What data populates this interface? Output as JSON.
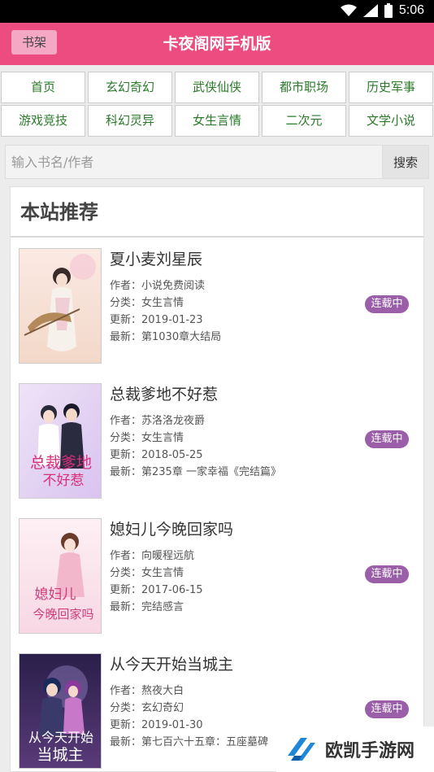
{
  "status": {
    "time": "5:06"
  },
  "header": {
    "shelf_label": "书架",
    "title": "卡夜阁网手机版"
  },
  "nav": [
    "首页",
    "玄幻奇幻",
    "武侠仙侠",
    "都市职场",
    "历史军事",
    "游戏竞技",
    "科幻灵异",
    "女生言情",
    "二次元",
    "文学小说"
  ],
  "search": {
    "placeholder": "输入书名/作者",
    "button_label": "搜索"
  },
  "section": {
    "title": "本站推荐"
  },
  "books": [
    {
      "title": "夏小麦刘星辰",
      "author": "作者：小说免费阅读",
      "category": "分类：女生言情",
      "updated": "更新：2019-01-23",
      "latest": "最新：第1030章大结局",
      "status": "连载中",
      "cover_text": ""
    },
    {
      "title": "总裁爹地不好惹",
      "author": "作者：苏洛洛龙夜爵",
      "category": "分类：女生言情",
      "updated": "更新：2018-05-25",
      "latest": "最新：第235章 一家幸福《完结篇》",
      "status": "连载中",
      "cover_text": "总裁爹地不好惹"
    },
    {
      "title": "媳妇儿今晚回家吗",
      "author": "作者：向暖程远航",
      "category": "分类：女生言情",
      "updated": "更新：2017-06-15",
      "latest": "最新：完结感言",
      "status": "连载中",
      "cover_text": "媳妇儿今晚回家吗"
    },
    {
      "title": "从今天开始当城主",
      "author": "作者：熬夜大白",
      "category": "分类：玄幻奇幻",
      "updated": "更新：2019-01-30",
      "latest": "最新：第七百六十五章：五座墓碑",
      "status": "连载中",
      "cover_text": "从今天开始当城主"
    }
  ],
  "watermark": {
    "text": "欧凯手游网"
  },
  "colors": {
    "brand": "#ec4c80",
    "nav_text": "#2a7a2a",
    "badge": "#9a5fa8"
  }
}
